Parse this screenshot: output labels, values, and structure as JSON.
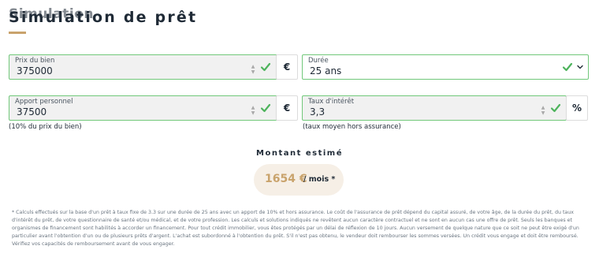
{
  "header": {
    "title": "Simulation de prêt",
    "title_overlay": "Simulation",
    "accent_color": "#c9a36c"
  },
  "fields": {
    "prix": {
      "label": "Prix du bien",
      "value": "375000",
      "unit": "€",
      "helper": ""
    },
    "duree": {
      "label": "Durée",
      "value": "25 ans"
    },
    "apport": {
      "label": "Apport personnel",
      "value": "37500",
      "unit": "€",
      "helper": "(10% du prix du bien)"
    },
    "taux": {
      "label": "Taux d'intérêt",
      "value": "3,3",
      "unit": "%",
      "helper": "(taux moyen hors assurance)"
    }
  },
  "icons": {
    "valid": "check-icon",
    "stepper": "stepper-icon",
    "dropdown": "chevron-down-icon"
  },
  "estimate": {
    "title": "Montant estimé",
    "amount": "1654 €",
    "per_month": "/ mois *"
  },
  "disclaimer": "* Calculs effectués sur la base d'un prêt à taux fixe de 3.3 sur une durée de 25 ans avec un apport de 10% et hors assurance. Le coût de l'assurance de prêt dépend du capital assuré, de votre âge, de la durée du prêt, du taux d'intérêt du prêt, de votre questionnaire de santé et/ou médical, et de votre profession. Les calculs et solutions indiqués ne revêtent aucun caractère contractuel et ne sont en aucun cas une offre de prêt. Seuls les banques et organismes de financement sont habilités à accorder un financement. Pour tout crédit immobilier, vous êtes protégés par un délai de réflexion de 10 jours. Aucun versement de quelque nature que ce soit ne peut être exigé d'un particulier avant l'obtention d'un ou de plusieurs prêts d'argent. L'achat est subordonné à l'obtention du prêt. S'il n'est pas obtenu, le vendeur doit rembourser les sommes versées. Un crédit vous engage et doit être remboursé. Vérifiez vos capacités de remboursement avant de vous engager.",
  "colors": {
    "valid_border": "#71c87a",
    "check": "#4db35c",
    "field_bg": "#f1f1f1",
    "pill_bg": "#f6efe6"
  }
}
